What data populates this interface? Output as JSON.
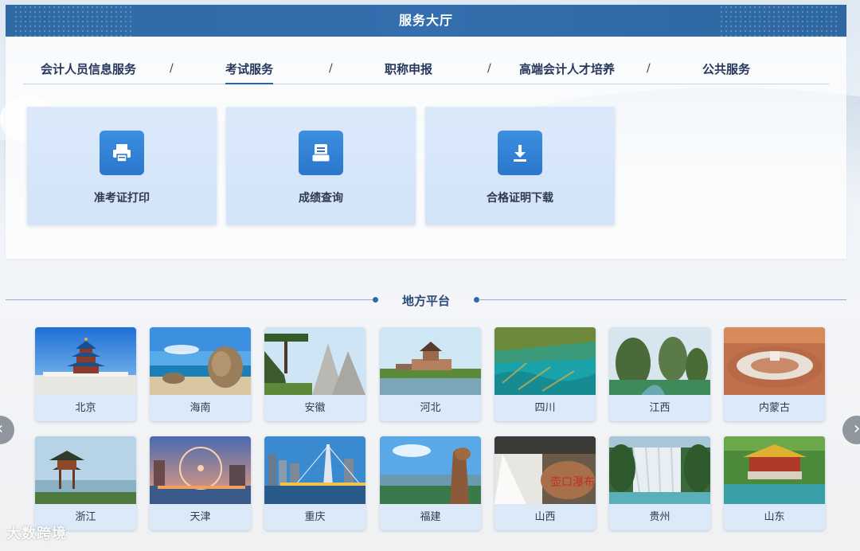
{
  "hall": {
    "title": "服务大厅",
    "tabs": [
      {
        "label": "会计人员信息服务"
      },
      {
        "label": "考试服务",
        "active": true
      },
      {
        "label": "职称申报"
      },
      {
        "label": "高端会计人才培养"
      },
      {
        "label": "公共服务"
      }
    ],
    "separator": "/",
    "cards": [
      {
        "label": "准考证打印",
        "icon": "printer-icon"
      },
      {
        "label": "成绩查询",
        "icon": "document-icon"
      },
      {
        "label": "合格证明下载",
        "icon": "download-icon"
      }
    ]
  },
  "local": {
    "title": "地方平台",
    "provinces": [
      "北京",
      "海南",
      "安徽",
      "河北",
      "四川",
      "江西",
      "内蒙古",
      "浙江",
      "天津",
      "重庆",
      "福建",
      "山西",
      "贵州",
      "山东"
    ]
  },
  "carousel": {
    "prev_glyph": "‹",
    "next_glyph": "›"
  },
  "watermark": "大数跨境",
  "colors": {
    "header": "#2f6aa4",
    "icon_bg": "#2a76cc",
    "card_bg": "#dbe9fa"
  }
}
